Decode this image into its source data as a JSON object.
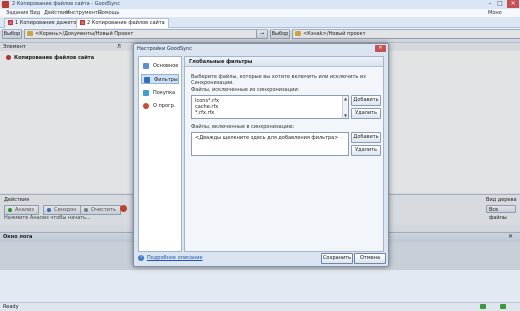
{
  "window": {
    "title": "2 Копирование файлов сайта - GoodSync"
  },
  "menu": [
    "Задания",
    "Вид",
    "Действия",
    "Инструменты",
    "Помощь"
  ],
  "account": {
    "label": "Моно Режим"
  },
  "tabs": [
    {
      "label": "1 Копирование дажетов"
    },
    {
      "label": "2 Копирование файлов сайта"
    }
  ],
  "paths": {
    "browse_label": "Выбор",
    "left": "<Корень>/Документы/Новый Проект",
    "right": "<Кзнаk>/Новый проект"
  },
  "columns": {
    "element": "Элемент",
    "left_marker": "Л"
  },
  "tasks": [
    {
      "name": "Копирование файлов сайта"
    }
  ],
  "actions": {
    "header": "Действия",
    "buttons": [
      "Анализ",
      "Синхрон",
      "Очистить"
    ],
    "hint": "Нажмите Анализ чтобы начать...",
    "right_label": "Вид дерева",
    "right_select": "Все файлы"
  },
  "log": {
    "title": "Окно лога"
  },
  "status": {
    "left": "Ready"
  },
  "dialog": {
    "title": "Настройки GoodSync",
    "close": "✕",
    "nav": [
      {
        "label": "Основное",
        "color": "#5b8fd6"
      },
      {
        "label": "Фильтры",
        "color": "#2f6fbf"
      },
      {
        "label": "Покупка",
        "color": "#3aa0d8"
      },
      {
        "label": "О прогр.",
        "color": "#d4482e"
      }
    ],
    "section_title": "Глобальные фильтры",
    "description": "Выберите файлы, которые вы хотите включить или исключить из Синхронизации.",
    "exclude_label": "Файлы, исключенные из синхронизации:",
    "exclude_items": [
      "Icons*.rfx",
      "cache.rfx",
      "*.rfx.rfx"
    ],
    "include_label": "Файлы, включенные в синхронизацию:",
    "include_placeholder": "<Дважды щелкните здесь для добавления фильтра>",
    "add_button": "Добавить",
    "delete_button": "Удалить",
    "help_link": "Подробное описание",
    "save_button": "Сохранить",
    "cancel_button": "Отмена"
  }
}
